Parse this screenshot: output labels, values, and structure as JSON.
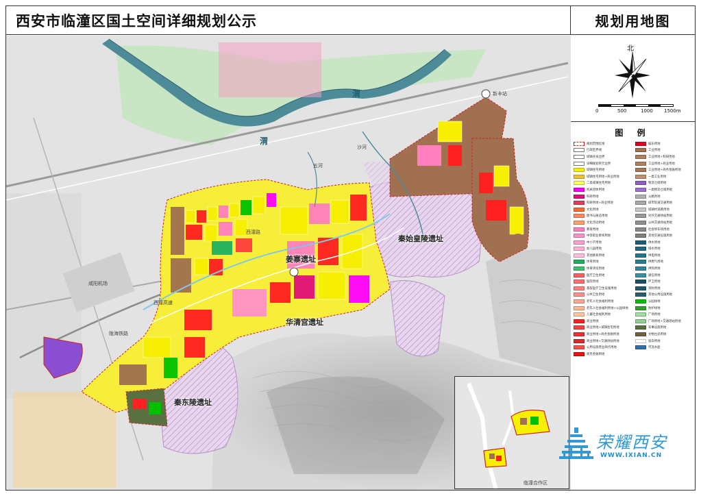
{
  "title": "西安市临潼区国土空间详细规划公示",
  "panel_title": "规划用地图",
  "north": "北",
  "scale": [
    "0",
    "500",
    "1000",
    "1500m"
  ],
  "legend": {
    "title": "图 例",
    "left": [
      {
        "label": "规划范围红线",
        "color": "#ffffff"
      },
      {
        "label": "行政区界线",
        "color": "#ffffff"
      },
      {
        "label": "城镇开发边界",
        "color": "#ffffff"
      },
      {
        "label": "详细规划单元边界",
        "color": "#ffffff"
      },
      {
        "label": "城镇住宅用地",
        "color": "#f7f000"
      },
      {
        "label": "城镇住宅用地+商业用地",
        "color": "#f0c030"
      },
      {
        "label": "二类城镇住宅用地",
        "color": "#fcff60"
      },
      {
        "label": "机关团体用地",
        "color": "#ff00ff"
      },
      {
        "label": "科研用地",
        "color": "#e0107a"
      },
      {
        "label": "科研用地+商业用地",
        "color": "#e04060"
      },
      {
        "label": "文化用地",
        "color": "#ff6a30"
      },
      {
        "label": "图书与展览用地",
        "color": "#ff8a60"
      },
      {
        "label": "文化活动用地",
        "color": "#ffa070"
      },
      {
        "label": "教育用地",
        "color": "#ff7fbf"
      },
      {
        "label": "中等职业教育用地",
        "color": "#ff92c8"
      },
      {
        "label": "中小学用地",
        "color": "#ffa0d0"
      },
      {
        "label": "幼儿园用地",
        "color": "#ffb0d8"
      },
      {
        "label": "其他教育用地",
        "color": "#ffc0e0"
      },
      {
        "label": "体育用地",
        "color": "#20b060"
      },
      {
        "label": "体育场馆用地",
        "color": "#40c070"
      },
      {
        "label": "医疗卫生用地",
        "color": "#ff6060"
      },
      {
        "label": "医院用地",
        "color": "#ff7070"
      },
      {
        "label": "基层医疗卫生设施用地",
        "color": "#ff8080"
      },
      {
        "label": "公共卫生用地",
        "color": "#ff9090"
      },
      {
        "label": "老年人社会福利用地",
        "color": "#ffa890"
      },
      {
        "label": "老年人社会福利用地+公园绿地",
        "color": "#ffb890"
      },
      {
        "label": "儿童社会福利用地",
        "color": "#ffc8a0"
      },
      {
        "label": "商业用地",
        "color": "#ff2020"
      },
      {
        "label": "商业用地+城镇住宅用地",
        "color": "#ff4040"
      },
      {
        "label": "商业用地+商务金融用地",
        "color": "#f03030"
      },
      {
        "label": "商业用地+交通场站用地",
        "color": "#e02828"
      },
      {
        "label": "公用设施营业网点用地",
        "color": "#ff5050"
      },
      {
        "label": "商务金融用地",
        "color": "#ee1010"
      }
    ],
    "right": [
      {
        "label": "娱乐用地",
        "color": "#e00020"
      },
      {
        "label": "工业用地",
        "color": "#a07050"
      },
      {
        "label": "工业用地+科研用地",
        "color": "#b07e60"
      },
      {
        "label": "工业用地+商业用地",
        "color": "#b08060"
      },
      {
        "label": "工业用地+商务金融用地",
        "color": "#a87858"
      },
      {
        "label": "一类工业用地",
        "color": "#c09070"
      },
      {
        "label": "物流仓储用地",
        "color": "#9060c0"
      },
      {
        "label": "一类物流仓储用地",
        "color": "#a070d0"
      },
      {
        "label": "公路用地",
        "color": "#b0b0b0"
      },
      {
        "label": "城市轨道交通用地",
        "color": "#a8a8a8"
      },
      {
        "label": "城镇村道路用地",
        "color": "#c8c8c8"
      },
      {
        "label": "对外交通场站用地",
        "color": "#9a9a9a"
      },
      {
        "label": "公共交通场站用地",
        "color": "#909090"
      },
      {
        "label": "社会停车场用地",
        "color": "#888888"
      },
      {
        "label": "其他交通设施用地",
        "color": "#808080"
      },
      {
        "label": "供水用地",
        "color": "#1a5f7a"
      },
      {
        "label": "排水用地",
        "color": "#206a80"
      },
      {
        "label": "供电用地",
        "color": "#257488"
      },
      {
        "label": "供燃气用地",
        "color": "#2a7e90"
      },
      {
        "label": "供热用地",
        "color": "#308898"
      },
      {
        "label": "通信用地",
        "color": "#3592a0"
      },
      {
        "label": "环卫用地",
        "color": "#1a5060"
      },
      {
        "label": "消防用地",
        "color": "#205868"
      },
      {
        "label": "其他公用设施用地",
        "color": "#286070"
      },
      {
        "label": "公园绿地",
        "color": "#00c000"
      },
      {
        "label": "防护绿地",
        "color": "#30a030"
      },
      {
        "label": "广场用地",
        "color": "#a0e0a0"
      },
      {
        "label": "广场用地+交通场站用地",
        "color": "#90d090"
      },
      {
        "label": "军事设施用地",
        "color": "#5a7040"
      },
      {
        "label": "文物古迹用地",
        "color": "#706040"
      },
      {
        "label": "留白用地",
        "color": "#ffffff"
      },
      {
        "label": "河流水面",
        "color": "#3070b0"
      }
    ]
  },
  "map_labels": {
    "qinshihuang": "秦始皇陵遗址",
    "jiangzhai": "姜寨遗址",
    "huaqing": "华清宫遗址",
    "qindong": "秦东陵遗址",
    "xinfeng": "新丰站",
    "xianyang_airport": "咸阳机场",
    "river_wei": "渭",
    "river_wei2": "渭",
    "river_sha": "沙河",
    "road1": "西潼高速",
    "road2": "陇海铁路",
    "wuhe": "五河",
    "gate": "西潼路",
    "inset": "临潼合作区"
  },
  "watermark": {
    "text": "荣耀西安",
    "url": "WWW.IXIAN.CN"
  }
}
